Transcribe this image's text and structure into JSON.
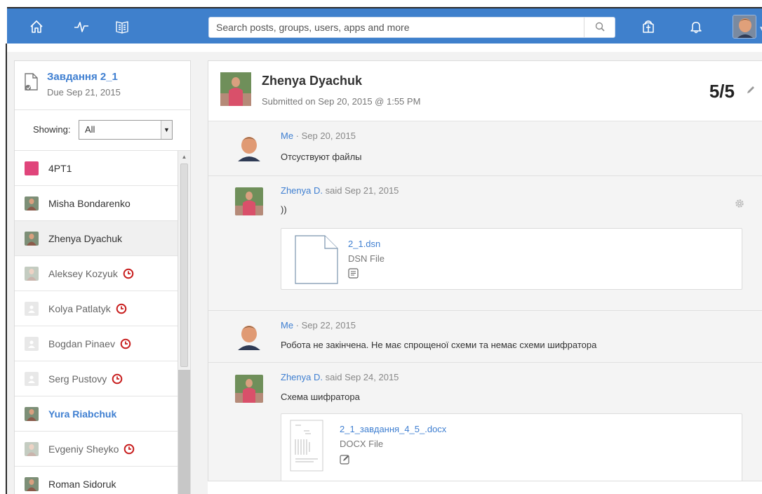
{
  "header": {
    "search_placeholder": "Search posts, groups, users, apps and more",
    "icons": [
      "home-icon",
      "activity-icon",
      "library-icon",
      "search-icon",
      "backpack-icon",
      "bell-icon"
    ],
    "brand_color": "#3f80cc"
  },
  "assignment": {
    "title": "Завдання 2_1",
    "due": "Due Sep 21, 2015"
  },
  "filter": {
    "label": "Showing:",
    "selected": "All"
  },
  "students": [
    {
      "name": "4PT1",
      "late": false,
      "type": "group",
      "color": "#e0457b"
    },
    {
      "name": "Misha Bondarenko",
      "late": false,
      "type": "photo"
    },
    {
      "name": "Zhenya Dyachuk",
      "late": false,
      "type": "photo",
      "selected": true
    },
    {
      "name": "Aleksey Kozyuk",
      "late": true,
      "type": "photo-faded"
    },
    {
      "name": "Kolya Patlatyk",
      "late": true,
      "type": "blank"
    },
    {
      "name": "Bogdan Pinaev",
      "late": true,
      "type": "blank"
    },
    {
      "name": "Serg Pustovy",
      "late": true,
      "type": "blank"
    },
    {
      "name": "Yura Riabchuk",
      "late": false,
      "type": "photo",
      "active": true
    },
    {
      "name": "Evgeniy Sheyko",
      "late": true,
      "type": "photo-faded"
    },
    {
      "name": "Roman Sidoruk",
      "late": false,
      "type": "photo"
    }
  ],
  "submission": {
    "student": "Zhenya Dyachuk",
    "submitted": "Submitted on Sep 20, 2015 @ 1:55 PM",
    "grade": "5/5"
  },
  "comments": [
    {
      "author": "Me",
      "sep": " · ",
      "date": "Sep 20, 2015",
      "text": "Отсуствуют файлы"
    },
    {
      "author": "Zhenya D.",
      "sep": " said ",
      "date": "Sep 21, 2015",
      "text": "))",
      "file": {
        "name": "2_1.dsn",
        "type": "DSN File"
      }
    },
    {
      "author": "Me",
      "sep": " · ",
      "date": "Sep 22, 2015",
      "text": "Робота не закінчена. Не має спрощеної схеми та немає схеми шифратора"
    },
    {
      "author": "Zhenya D.",
      "sep": " said ",
      "date": "Sep 24, 2015",
      "text": "Схема шифратора",
      "file": {
        "name": "2_1_завдання_4_5_.docx",
        "type": "DOCX File"
      }
    }
  ]
}
